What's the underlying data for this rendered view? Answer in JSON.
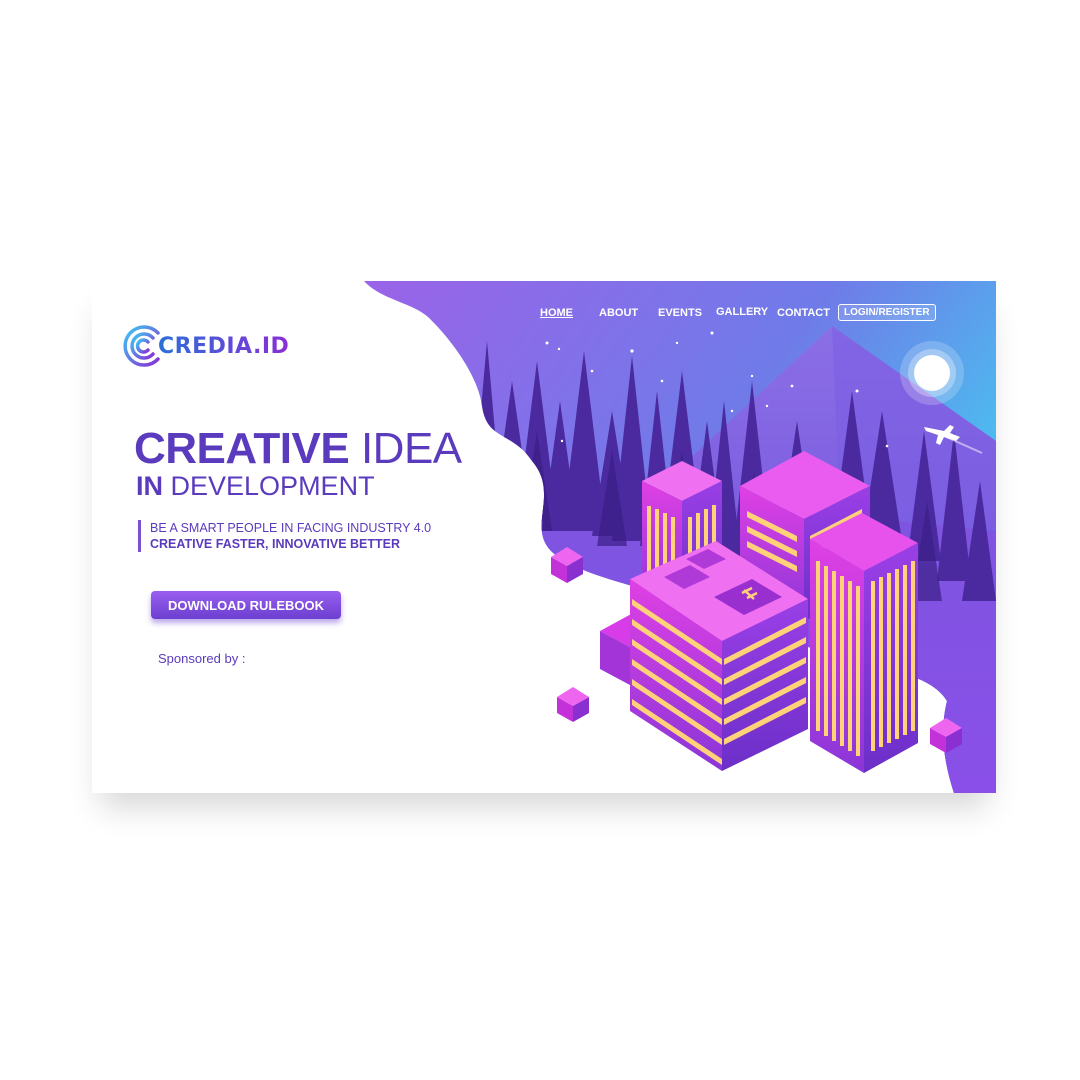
{
  "brand": {
    "name": "CREDIA.ID"
  },
  "nav": {
    "items": [
      "HOME",
      "ABOUT",
      "EVENTS",
      "GALLERY",
      "CONTACT"
    ],
    "active": "HOME",
    "login_label": "LOGIN/REGISTER"
  },
  "hero": {
    "title_bold": "CREATIVE",
    "title_light": "IDEA",
    "subtitle_bold": "IN",
    "subtitle_light": "DEVELOPMENT",
    "tagline_line1": "BE A SMART PEOPLE IN FACING INDUSTRY 4.0",
    "tagline_line2": "CREATIVE FASTER, INNOVATIVE BETTER",
    "download_label": "DOWNLOAD RULEBOOK",
    "sponsor_label": "Sponsored by :"
  },
  "colors": {
    "brand_purple": "#5b3bbd",
    "accent_violet": "#8a4fe0",
    "sky_cyan": "#3fd0f0",
    "building_magenta": "#d93be0",
    "window_yellow": "#ffd27a"
  },
  "illustration": {
    "icons": [
      "moon-icon",
      "airplane-icon",
      "helipad-icon",
      "cube-icon",
      "tree-icon",
      "building-icon",
      "star-icon"
    ]
  }
}
